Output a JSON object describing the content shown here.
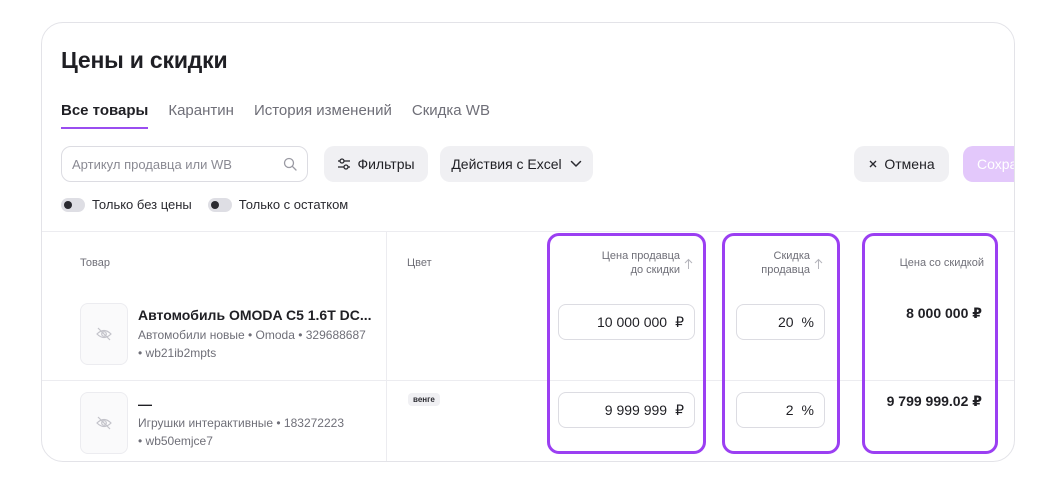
{
  "page": {
    "title": "Цены и скидки"
  },
  "tabs": [
    {
      "label": "Все товары",
      "active": true
    },
    {
      "label": "Карантин"
    },
    {
      "label": "История изменений"
    },
    {
      "label": "Скидка WB"
    }
  ],
  "toolbar": {
    "search_placeholder": "Артикул продавца или WB",
    "filters_label": "Фильтры",
    "excel_label": "Действия с Excel",
    "cancel_label": "Отмена",
    "save_label": "Сохра"
  },
  "toggles": [
    {
      "label": "Только без цены"
    },
    {
      "label": "Только с остатком"
    }
  ],
  "table": {
    "headers": {
      "product": "Товар",
      "color": "Цвет",
      "price_line1": "Цена продавца",
      "price_line2": "до скидки",
      "discount_line1": "Скидка",
      "discount_line2": "продавца",
      "final": "Цена со скидкой"
    },
    "rows": [
      {
        "name": "Автомобиль OMODA C5 1.6T DC...",
        "meta1": "Автомобили новые • Omoda • 329688687",
        "meta2": "• wb21ib2mpts",
        "color": "",
        "price": "10 000 000",
        "currency": "₽",
        "discount": "20",
        "percent": "%",
        "final": "8 000 000 ₽"
      },
      {
        "name": "—",
        "meta1": "Игрушки интерактивные • 183272223",
        "meta2": "• wb50emjce7",
        "color": "венге",
        "price": "9 999 999",
        "currency": "₽",
        "discount": "2",
        "percent": "%",
        "final": "9 799 999.02 ₽"
      }
    ]
  },
  "colors": {
    "accent": "#9a4df0",
    "highlight": "#9b3ff2",
    "save_button": "#e3c8fb"
  },
  "icons": [
    "search-icon",
    "filter-icon",
    "chevron-down-icon",
    "close-icon",
    "sort-arrow-icon",
    "no-image-icon"
  ]
}
